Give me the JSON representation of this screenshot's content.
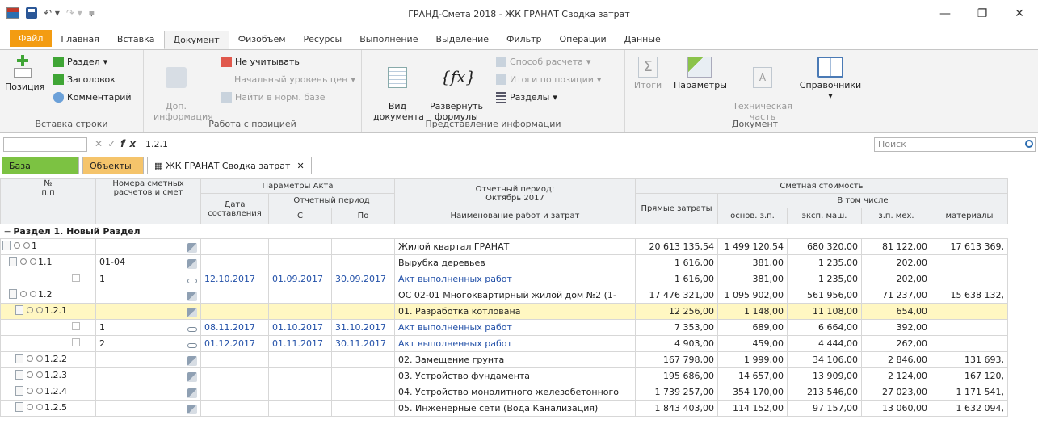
{
  "window": {
    "title": "ГРАНД-Смета 2018 - ЖК ГРАНАТ Сводка затрат",
    "minimize": "—",
    "restore": "❐",
    "close": "✕"
  },
  "ribbon_tabs": [
    "Файл",
    "Главная",
    "Вставка",
    "Документ",
    "Физобъем",
    "Ресурсы",
    "Выполнение",
    "Выделение",
    "Фильтр",
    "Операции",
    "Данные"
  ],
  "ribbon": {
    "insert_row": {
      "label": "Вставка строки",
      "position": "Позиция",
      "section": "Раздел",
      "header": "Заголовок",
      "comment": "Комментарий"
    },
    "position_work": {
      "label": "Работа с позицией",
      "extra_info": "Доп.\nинформация",
      "ignore": "Не учитывать",
      "price_level": "Начальный уровень цен",
      "find_norm": "Найти в норм. базе"
    },
    "info_view": {
      "label": "Представление информации",
      "doc_view": "Вид\nдокумента",
      "expand": "Развернуть\nформулы",
      "calc_method": "Способ расчета",
      "totals": "Итоги по позиции",
      "sections": "Разделы"
    },
    "document": {
      "label": "Документ",
      "totals": "Итоги",
      "params": "Параметры",
      "tech": "Техническая\nчасть",
      "refs": "Справочники"
    }
  },
  "formula_bar": {
    "value": "1.2.1",
    "fx": "fx",
    "search_placeholder": "Поиск"
  },
  "doc_tabs": {
    "base": "База",
    "objects": "Объекты",
    "current": "ЖК ГРАНАТ Сводка затрат",
    "close": "✕"
  },
  "table_header": {
    "no": "№\nп.п",
    "numbers": "Номера сметных\nрасчетов и смет",
    "act_params": "Параметры Акта",
    "date": "Дата\nсоставления",
    "period": "Отчетный период",
    "from": "С",
    "to": "По",
    "report_period": "Отчетный период:\nОктябрь 2017",
    "work_name": "Наименование работ и затрат",
    "estimate_cost": "Сметная стоимость",
    "direct": "Прямые затраты",
    "including": "В том числе",
    "base_wage": "основ. з.п.",
    "machines": "эксп. маш.",
    "mech_wage": "з.п. мех.",
    "materials": "материалы"
  },
  "section_title": "Раздел 1. Новый Раздел",
  "rows": [
    {
      "no": "1",
      "num": "",
      "date": "",
      "from": "",
      "to": "",
      "name": "Жилой квартал ГРАНАТ",
      "direct": "20 613 135,54",
      "base": "1 499 120,54",
      "mach": "680 320,00",
      "mech": "81 122,00",
      "mat": "17 613 369,"
    },
    {
      "no": "1.1",
      "num": "01-04",
      "date": "",
      "from": "",
      "to": "",
      "name": "Вырубка деревьев",
      "direct": "1 616,00",
      "base": "381,00",
      "mach": "1 235,00",
      "mech": "202,00",
      "mat": ""
    },
    {
      "no": "",
      "num": "1",
      "date": "12.10.2017",
      "from": "01.09.2017",
      "to": "30.09.2017",
      "name": "Акт выполненных работ",
      "direct": "1 616,00",
      "base": "381,00",
      "mach": "1 235,00",
      "mech": "202,00",
      "mat": ""
    },
    {
      "no": "1.2",
      "num": "",
      "date": "",
      "from": "",
      "to": "",
      "name": "ОС 02-01 Многоквартирный жилой дом №2 (1-",
      "direct": "17 476 321,00",
      "base": "1 095 902,00",
      "mach": "561 956,00",
      "mech": "71 237,00",
      "mat": "15 638 132,"
    },
    {
      "no": "1.2.1",
      "num": "",
      "date": "",
      "from": "",
      "to": "",
      "name": "01. Разработка котлована",
      "direct": "12 256,00",
      "base": "1 148,00",
      "mach": "11 108,00",
      "mech": "654,00",
      "mat": ""
    },
    {
      "no": "",
      "num": "1",
      "date": "08.11.2017",
      "from": "01.10.2017",
      "to": "31.10.2017",
      "name": "Акт выполненных работ",
      "direct": "7 353,00",
      "base": "689,00",
      "mach": "6 664,00",
      "mech": "392,00",
      "mat": ""
    },
    {
      "no": "",
      "num": "2",
      "date": "01.12.2017",
      "from": "01.11.2017",
      "to": "30.11.2017",
      "name": "Акт выполненных работ",
      "direct": "4 903,00",
      "base": "459,00",
      "mach": "4 444,00",
      "mech": "262,00",
      "mat": ""
    },
    {
      "no": "1.2.2",
      "num": "",
      "date": "",
      "from": "",
      "to": "",
      "name": "02. Замещение грунта",
      "direct": "167 798,00",
      "base": "1 999,00",
      "mach": "34 106,00",
      "mech": "2 846,00",
      "mat": "131 693,"
    },
    {
      "no": "1.2.3",
      "num": "",
      "date": "",
      "from": "",
      "to": "",
      "name": "03. Устройство фундамента",
      "direct": "195 686,00",
      "base": "14 657,00",
      "mach": "13 909,00",
      "mech": "2 124,00",
      "mat": "167 120,"
    },
    {
      "no": "1.2.4",
      "num": "",
      "date": "",
      "from": "",
      "to": "",
      "name": "04. Устройство монолитного железобетонного",
      "direct": "1 739 257,00",
      "base": "354 170,00",
      "mach": "213 546,00",
      "mech": "27 023,00",
      "mat": "1 171 541,"
    },
    {
      "no": "1.2.5",
      "num": "",
      "date": "",
      "from": "",
      "to": "",
      "name": "05. Инженерные сети (Вода Канализация)",
      "direct": "1 843 403,00",
      "base": "114 152,00",
      "mach": "97 157,00",
      "mech": "13 060,00",
      "mat": "1 632 094,"
    }
  ]
}
